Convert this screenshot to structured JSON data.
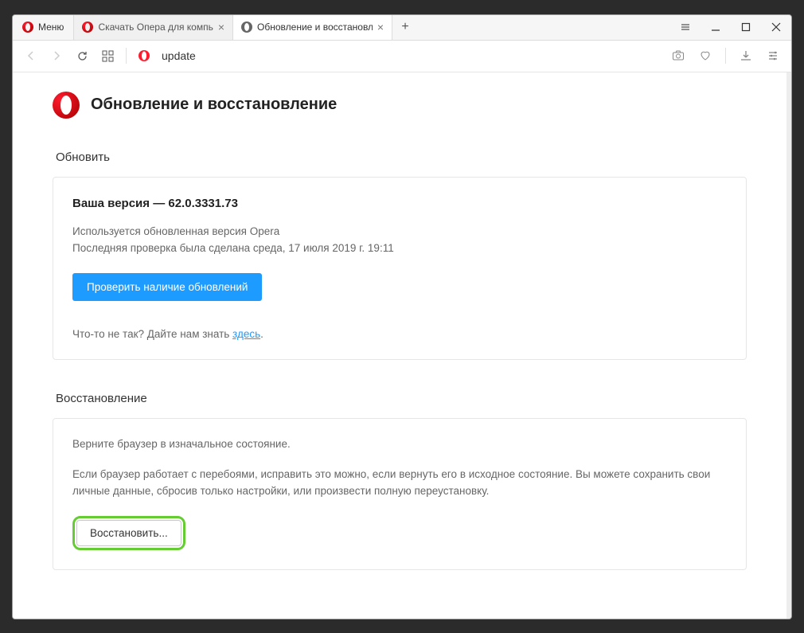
{
  "menu_label": "Меню",
  "tabs": [
    {
      "title": "Скачать Опера для компь",
      "active": false
    },
    {
      "title": "Обновление и восстановл",
      "active": true
    }
  ],
  "address": "update",
  "page": {
    "title": "Обновление и восстановление"
  },
  "update": {
    "section_label": "Обновить",
    "version_prefix": "Ваша версия — ",
    "version_number": "62.0.3331.73",
    "status_line": "Используется обновленная версия Opera",
    "last_check_line": "Последняя проверка была сделана среда, 17 июля 2019 г. 19:11",
    "check_button": "Проверить наличие обновлений",
    "feedback_prefix": "Что-то не так? Дайте нам знать ",
    "feedback_link": "здесь",
    "feedback_suffix": "."
  },
  "recovery": {
    "section_label": "Восстановление",
    "intro": "Верните браузер в изначальное состояние.",
    "body": "Если браузер работает с перебоями, исправить это можно, если вернуть его в исходное состояние. Вы можете сохранить свои личные данные, сбросив только настройки, или произвести полную переустановку.",
    "restore_button": "Восстановить..."
  }
}
